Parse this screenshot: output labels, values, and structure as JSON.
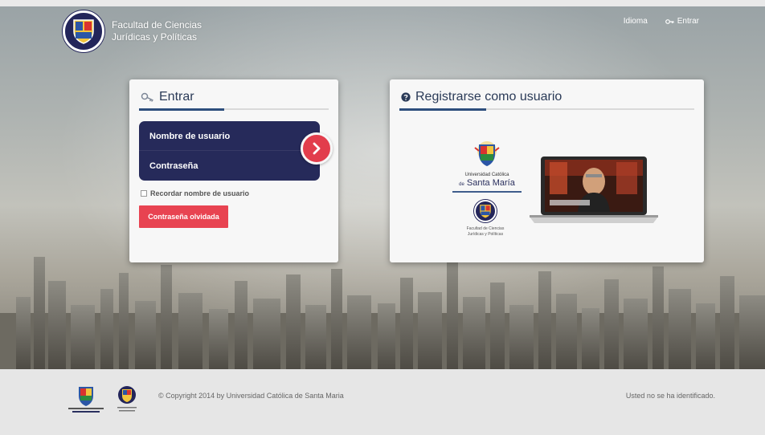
{
  "header": {
    "brand_line1": "Facultad de Ciencias",
    "brand_line2": "Jurídicas y Políticas",
    "nav": {
      "language": "Idioma",
      "login": "Entrar"
    }
  },
  "login_card": {
    "title": "Entrar",
    "username_placeholder": "Nombre de usuario",
    "password_placeholder": "Contraseña",
    "remember_label": "Recordar nombre de usuario",
    "forgot_label": "Contraseña olvidada"
  },
  "register_card": {
    "title": "Registrarse como usuario",
    "ucsm_small": "Universidad Católica",
    "ucsm_de": "de",
    "ucsm_big": "Santa María",
    "faculty_line1": "Facultad de Ciencias",
    "faculty_line2": "Jurídicas y Políticas"
  },
  "footer": {
    "copyright": "© Copyright 2014 by Universidad Católica de Santa Maria",
    "status": "Usted no se ha identificado."
  },
  "colors": {
    "navy": "#262a5a",
    "accent_red": "#e84351",
    "title_blue": "#2a3a57"
  }
}
